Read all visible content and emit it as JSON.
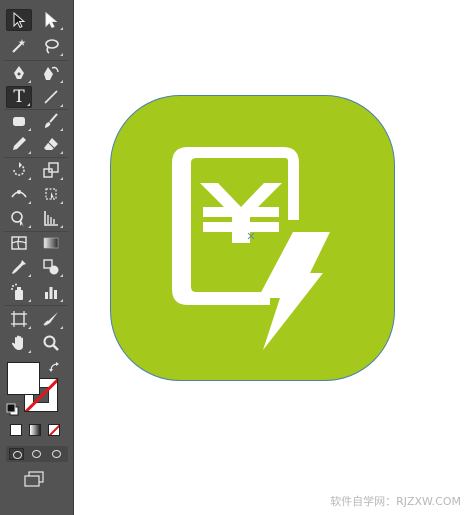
{
  "toolbar": {
    "active_tool": "type-tool",
    "tools": [
      [
        "selection-tool",
        "direct-selection-tool"
      ],
      [
        "magic-wand-tool",
        "lasso-tool"
      ],
      [
        "pen-tool",
        "curvature-tool"
      ],
      [
        "type-tool",
        "line-segment-tool"
      ],
      [
        "rectangle-tool",
        "paintbrush-tool"
      ],
      [
        "pencil-tool",
        "eraser-tool"
      ],
      [
        "rotate-tool",
        "scale-tool"
      ],
      [
        "width-tool",
        "free-transform-tool"
      ],
      [
        "shape-builder-tool",
        "perspective-grid-tool"
      ],
      [
        "mesh-tool",
        "gradient-tool"
      ],
      [
        "eyedropper-tool",
        "blend-tool"
      ],
      [
        "symbol-sprayer-tool",
        "column-graph-tool"
      ],
      [
        "artboard-tool",
        "slice-tool"
      ],
      [
        "hand-tool",
        "zoom-tool"
      ]
    ],
    "type_tool_glyph": "T"
  },
  "colors": {
    "panel": "#535353",
    "icon_green": "#a4c91c",
    "icon_outline": "#4a7fb0",
    "glyph_white": "#ffffff",
    "none_red": "#e01818"
  },
  "artwork": {
    "icon_name": "yuan-phone-lightning-icon"
  },
  "watermark": {
    "text": "软件自学网：RJZXW.COM"
  }
}
